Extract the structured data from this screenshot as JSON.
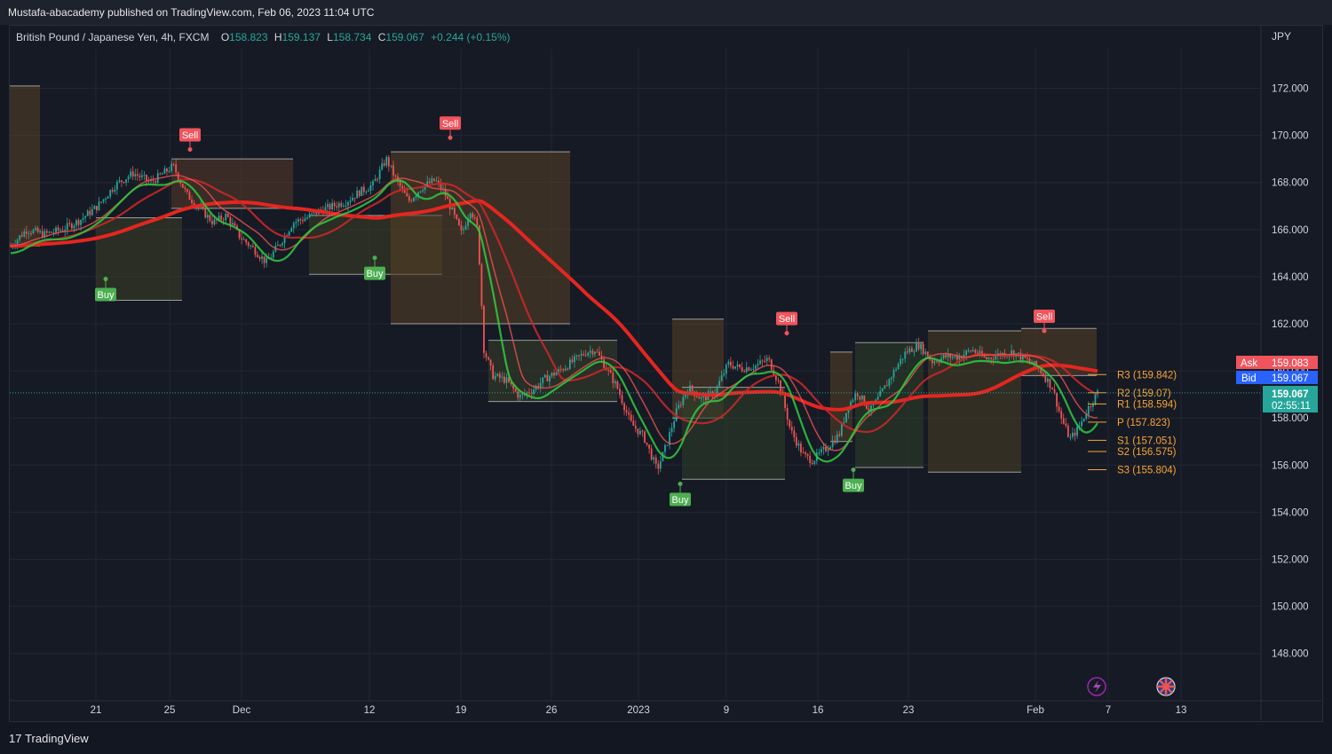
{
  "header": {
    "published": "Mustafa-abacademy published on TradingView.com, Feb 06, 2023 11:04 UTC"
  },
  "legend": {
    "symbol": "British Pound / Japanese Yen, 4h, FXCM",
    "o_label": "O",
    "o_value": "158.823",
    "h_label": "H",
    "h_value": "159.137",
    "l_label": "L",
    "l_value": "158.734",
    "c_label": "C",
    "c_value": "159.067",
    "change": "+0.244 (+0.15%)"
  },
  "axis": {
    "currency": "JPY"
  },
  "price_badges": {
    "ask_label": "Ask",
    "ask_value": "159.083",
    "bid_label": "Bid",
    "bid_value": "159.067",
    "last_value": "159.067",
    "countdown": "02:55:11"
  },
  "colors": {
    "background": "#161a25",
    "up": "#26a69a",
    "down": "#ef5350",
    "signal_buy": "#4caf50",
    "signal_sell": "#f0545c",
    "pivot": "#f7a535"
  },
  "footer": {
    "brand": "TradingView",
    "logo_text": "17"
  },
  "chart_data": {
    "type": "candlestick",
    "title": "British Pound / Japanese Yen, 4h, FXCM",
    "ylabel": "JPY",
    "ylim": [
      146.0,
      174.0
    ],
    "grid": true,
    "y_ticks": [
      "172.000",
      "170.000",
      "168.000",
      "166.000",
      "164.000",
      "162.000",
      "160.000",
      "158.000",
      "156.000",
      "154.000",
      "152.000",
      "150.000",
      "148.000"
    ],
    "x_ticks": [
      {
        "label": "21",
        "x": 108
      },
      {
        "label": "25",
        "x": 191
      },
      {
        "label": "Dec",
        "x": 272
      },
      {
        "label": "12",
        "x": 416
      },
      {
        "label": "19",
        "x": 519
      },
      {
        "label": "26",
        "x": 621
      },
      {
        "label": "2023",
        "x": 719
      },
      {
        "label": "9",
        "x": 818
      },
      {
        "label": "16",
        "x": 921
      },
      {
        "label": "23",
        "x": 1023
      },
      {
        "label": "Feb",
        "x": 1166
      },
      {
        "label": "7",
        "x": 1248
      },
      {
        "label": "13",
        "x": 1330
      }
    ],
    "pivot_levels": [
      {
        "label": "R3 (159.842)",
        "value": 159.842
      },
      {
        "label": "R2 (159.07)",
        "value": 159.07
      },
      {
        "label": "R1 (158.594)",
        "value": 158.594
      },
      {
        "label": "P (157.823)",
        "value": 157.823
      },
      {
        "label": "S1 (157.051)",
        "value": 157.051
      },
      {
        "label": "S2 (156.575)",
        "value": 156.575
      },
      {
        "label": "S3 (155.804)",
        "value": 155.804
      }
    ],
    "signals": [
      {
        "type": "Buy",
        "x": 119,
        "price": 163.9
      },
      {
        "type": "Sell",
        "x": 214,
        "price": 169.4
      },
      {
        "type": "Buy",
        "x": 422,
        "price": 164.8
      },
      {
        "type": "Sell",
        "x": 507,
        "price": 169.9
      },
      {
        "type": "Buy",
        "x": 766,
        "price": 155.2
      },
      {
        "type": "Sell",
        "x": 886,
        "price": 161.6
      },
      {
        "type": "Buy",
        "x": 961,
        "price": 155.8
      },
      {
        "type": "Sell",
        "x": 1176,
        "price": 161.7
      }
    ],
    "close_path": [
      [
        12,
        165.3
      ],
      [
        30,
        166.0
      ],
      [
        50,
        165.8
      ],
      [
        70,
        166.0
      ],
      [
        90,
        166.4
      ],
      [
        110,
        167.0
      ],
      [
        130,
        167.9
      ],
      [
        150,
        168.4
      ],
      [
        170,
        168.0
      ],
      [
        195,
        168.7
      ],
      [
        210,
        167.5
      ],
      [
        225,
        166.9
      ],
      [
        240,
        166.3
      ],
      [
        255,
        166.6
      ],
      [
        270,
        165.7
      ],
      [
        285,
        165.2
      ],
      [
        300,
        164.6
      ],
      [
        315,
        165.4
      ],
      [
        330,
        166.3
      ],
      [
        345,
        166.5
      ],
      [
        360,
        166.8
      ],
      [
        375,
        167.0
      ],
      [
        390,
        167.2
      ],
      [
        405,
        167.6
      ],
      [
        420,
        167.9
      ],
      [
        435,
        169.0
      ],
      [
        445,
        168.2
      ],
      [
        460,
        167.2
      ],
      [
        475,
        167.8
      ],
      [
        490,
        168.1
      ],
      [
        500,
        167.6
      ],
      [
        510,
        166.7
      ],
      [
        520,
        165.8
      ],
      [
        530,
        166.9
      ],
      [
        538,
        166.0
      ],
      [
        545,
        160.9
      ],
      [
        555,
        159.8
      ],
      [
        570,
        159.6
      ],
      [
        585,
        158.9
      ],
      [
        600,
        159.2
      ],
      [
        615,
        159.7
      ],
      [
        630,
        160.0
      ],
      [
        645,
        160.4
      ],
      [
        660,
        160.8
      ],
      [
        670,
        160.9
      ],
      [
        680,
        160.3
      ],
      [
        695,
        159.3
      ],
      [
        710,
        157.8
      ],
      [
        725,
        157.2
      ],
      [
        740,
        155.8
      ],
      [
        750,
        156.8
      ],
      [
        762,
        158.3
      ],
      [
        775,
        159.3
      ],
      [
        790,
        158.8
      ],
      [
        805,
        159.1
      ],
      [
        820,
        160.3
      ],
      [
        835,
        160.1
      ],
      [
        850,
        160.2
      ],
      [
        865,
        160.5
      ],
      [
        878,
        159.4
      ],
      [
        890,
        157.5
      ],
      [
        905,
        156.4
      ],
      [
        915,
        156.2
      ],
      [
        930,
        156.7
      ],
      [
        945,
        157.3
      ],
      [
        955,
        158.5
      ],
      [
        965,
        159.1
      ],
      [
        980,
        158.3
      ],
      [
        995,
        159.2
      ],
      [
        1010,
        160.2
      ],
      [
        1020,
        160.8
      ],
      [
        1035,
        161.1
      ],
      [
        1050,
        160.4
      ],
      [
        1065,
        160.6
      ],
      [
        1080,
        160.6
      ],
      [
        1095,
        160.9
      ],
      [
        1110,
        160.5
      ],
      [
        1125,
        160.7
      ],
      [
        1140,
        160.8
      ],
      [
        1155,
        160.5
      ],
      [
        1170,
        160.1
      ],
      [
        1185,
        159.3
      ],
      [
        1195,
        158.0
      ],
      [
        1205,
        157.1
      ],
      [
        1215,
        157.6
      ],
      [
        1225,
        158.4
      ],
      [
        1236,
        159.067
      ]
    ]
  }
}
